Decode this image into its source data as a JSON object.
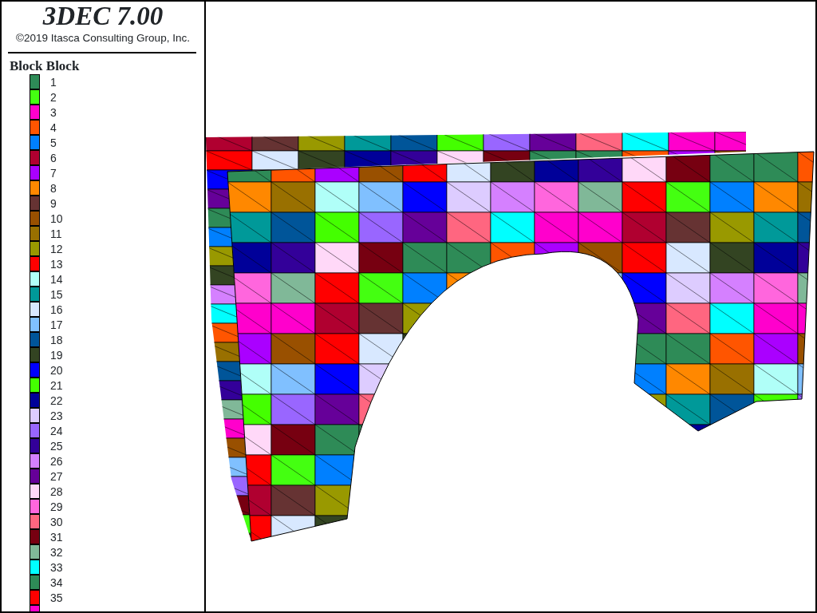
{
  "title": "3DEC 7.00",
  "copyright": "©2019 Itasca Consulting Group, Inc.",
  "legend": {
    "title": "Block Block",
    "items": [
      {
        "label": "1",
        "color": "#2e8b57"
      },
      {
        "label": "2",
        "color": "#44ff11"
      },
      {
        "label": "3",
        "color": "#ff00cc"
      },
      {
        "label": "4",
        "color": "#ff5500"
      },
      {
        "label": "5",
        "color": "#0080ff"
      },
      {
        "label": "6",
        "color": "#b00030"
      },
      {
        "label": "7",
        "color": "#aa00ff"
      },
      {
        "label": "8",
        "color": "#ff8800"
      },
      {
        "label": "9",
        "color": "#663333"
      },
      {
        "label": "10",
        "color": "#995000"
      },
      {
        "label": "11",
        "color": "#997000"
      },
      {
        "label": "12",
        "color": "#999900"
      },
      {
        "label": "13",
        "color": "#ff0000"
      },
      {
        "label": "14",
        "color": "#b0fff8"
      },
      {
        "label": "15",
        "color": "#009999"
      },
      {
        "label": "16",
        "color": "#d8e8ff"
      },
      {
        "label": "17",
        "color": "#80c0ff"
      },
      {
        "label": "18",
        "color": "#005599"
      },
      {
        "label": "19",
        "color": "#334422"
      },
      {
        "label": "20",
        "color": "#0000ff"
      },
      {
        "label": "21",
        "color": "#44ff00"
      },
      {
        "label": "22",
        "color": "#000099"
      },
      {
        "label": "23",
        "color": "#ddccff"
      },
      {
        "label": "24",
        "color": "#9966ff"
      },
      {
        "label": "25",
        "color": "#330099"
      },
      {
        "label": "26",
        "color": "#d580ff"
      },
      {
        "label": "27",
        "color": "#660099"
      },
      {
        "label": "28",
        "color": "#ffd8f8"
      },
      {
        "label": "29",
        "color": "#ff66dd"
      },
      {
        "label": "30",
        "color": "#ff6680"
      },
      {
        "label": "31",
        "color": "#770011"
      },
      {
        "label": "32",
        "color": "#80b898"
      },
      {
        "label": "33",
        "color": "#00ffff"
      },
      {
        "label": "34",
        "color": "#2e8b57"
      },
      {
        "label": "35",
        "color": "#ff0000"
      },
      {
        "color": "#ff00cc"
      }
    ]
  }
}
